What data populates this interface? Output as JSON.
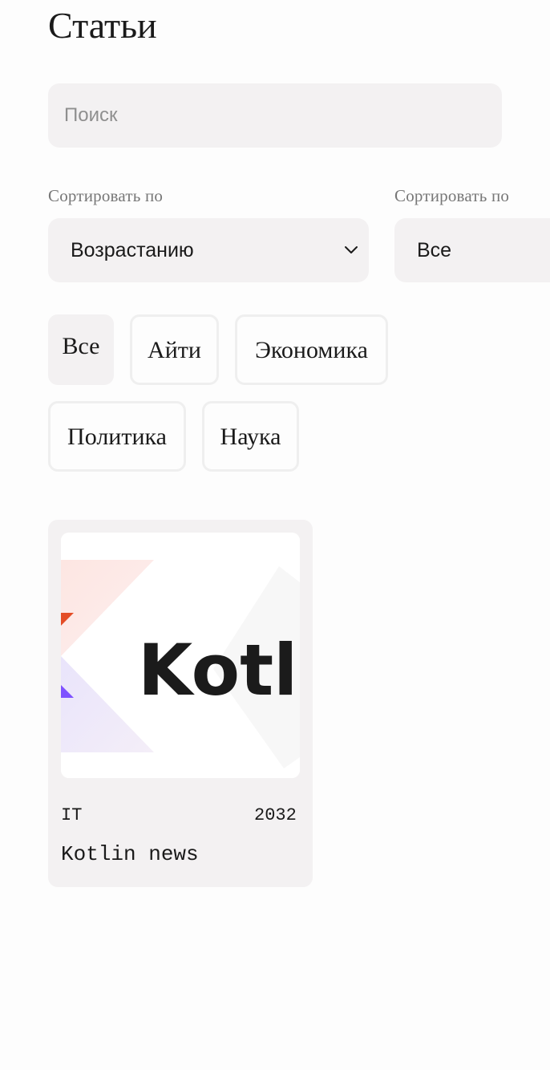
{
  "page": {
    "title": "Статьи"
  },
  "search": {
    "placeholder": "Поиск",
    "value": ""
  },
  "sort": {
    "order_label": "Сортировать  по",
    "order_value": "Возрастанию",
    "field_label": "Сортировать  по",
    "field_value": "Все"
  },
  "filters": {
    "items": [
      {
        "label": "Все",
        "active": true
      },
      {
        "label": "Айти",
        "active": false
      },
      {
        "label": "Экономика",
        "active": false
      },
      {
        "label": "Политика",
        "active": false
      },
      {
        "label": "Наука",
        "active": false
      }
    ]
  },
  "articles": [
    {
      "image_icon": "kotlin-logo",
      "image_text": "Kotli",
      "category": "IT",
      "year": "2032",
      "title": "Kotlin news"
    }
  ],
  "colors": {
    "background": "#fdfdfd",
    "field_background": "#f3f1f2",
    "chip_border": "#efefef",
    "text": "#1a1a1a",
    "muted_text": "#777777",
    "kotlin_orange": "#e44d26",
    "kotlin_purple": "#7f52ff"
  }
}
